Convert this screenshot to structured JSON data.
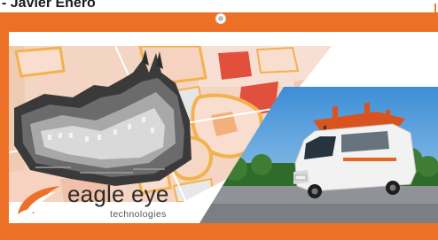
{
  "header": {
    "partial_title": "- Javier Enero"
  },
  "banner": {
    "brand": {
      "name": "eagle eye",
      "tagline": "technologies",
      "logo_icon": "eagle-eye-swoosh-icon"
    },
    "images": {
      "left": "city-map-3d-pointcloud-image",
      "right": "survey-van-lidar-image"
    },
    "colors": {
      "frame": "#ec7025",
      "panel": "#ffffff",
      "map_block": "#f6d7c4",
      "map_road": "#f2b24d"
    }
  }
}
